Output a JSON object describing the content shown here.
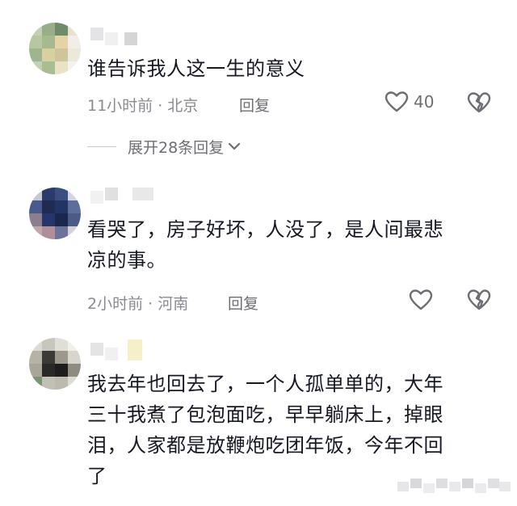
{
  "comments": [
    {
      "text": "谁告诉我人这一生的意义",
      "time_location": "11小时前 · 北京",
      "reply_label": "回复",
      "like_count": "40",
      "expand_label": "展开28条回复"
    },
    {
      "text_line1": "看哭了，房子好坏，人没了，是人间最悲",
      "text_line2": "凉的事。",
      "time_location": "2小时前 · 河南",
      "reply_label": "回复"
    },
    {
      "text_line1": "我去年也回去了，一个人孤单单的，大年",
      "text_line2": "三十我煮了包泡面吃，早早躺床上，掉眼",
      "text_line3": "泪，人家都是放鞭炮吃团年饭，今年不回",
      "text_line4": "了"
    }
  ],
  "icons": {
    "like": "heart-outline-icon",
    "dislike": "broken-heart-icon",
    "expand": "chevron-down-icon"
  },
  "colors": {
    "text": "#161823",
    "meta": "#8a8b91",
    "icon": "#6d6e74"
  }
}
